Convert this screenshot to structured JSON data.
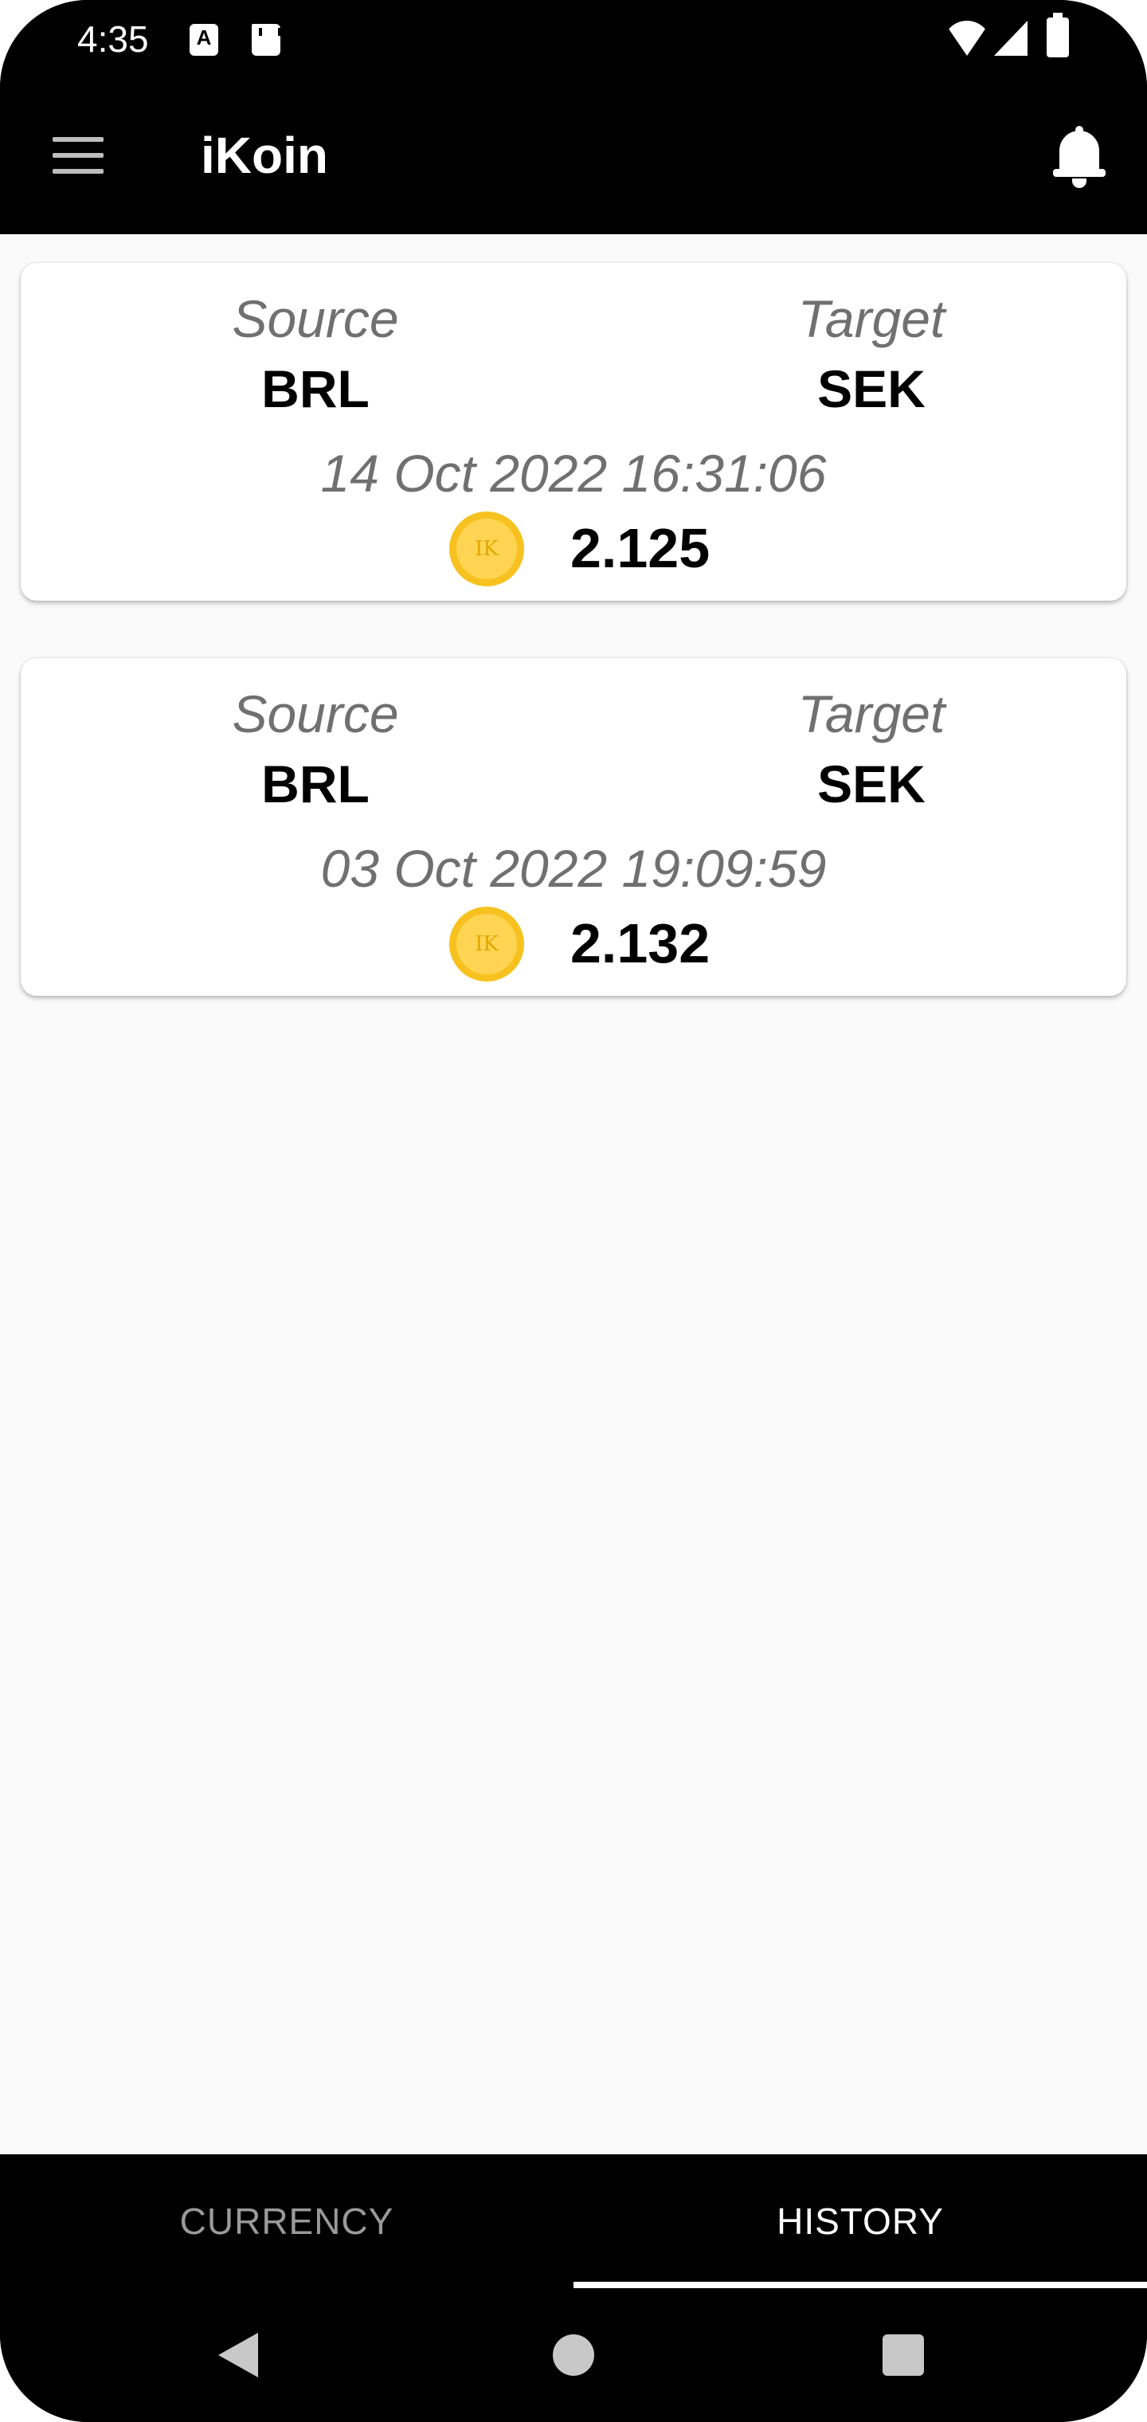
{
  "status_bar": {
    "time": "4:35",
    "a_icon_label": "A",
    "icons": [
      "a-notification-icon",
      "sd-card-icon",
      "wifi-icon",
      "signal-icon",
      "battery-icon"
    ]
  },
  "app_bar": {
    "title": "iKoin",
    "left_icon": "menu-icon",
    "right_icon": "bell-icon"
  },
  "history": [
    {
      "source_label": "Source",
      "source_code": "BRL",
      "target_label": "Target",
      "target_code": "SEK",
      "date": "14 Oct 2022 16:31:06",
      "coin_text": "IK",
      "rate": "2.125"
    },
    {
      "source_label": "Source",
      "source_code": "BRL",
      "target_label": "Target",
      "target_code": "SEK",
      "date": "03 Oct 2022 19:09:59",
      "coin_text": "IK",
      "rate": "2.132"
    }
  ],
  "tabs": [
    {
      "label": "CURRENCY",
      "selected": false
    },
    {
      "label": "HISTORY",
      "selected": true
    }
  ],
  "colors": {
    "coin": "#f7c21f",
    "background": "#fafafa",
    "bar": "#000000"
  }
}
